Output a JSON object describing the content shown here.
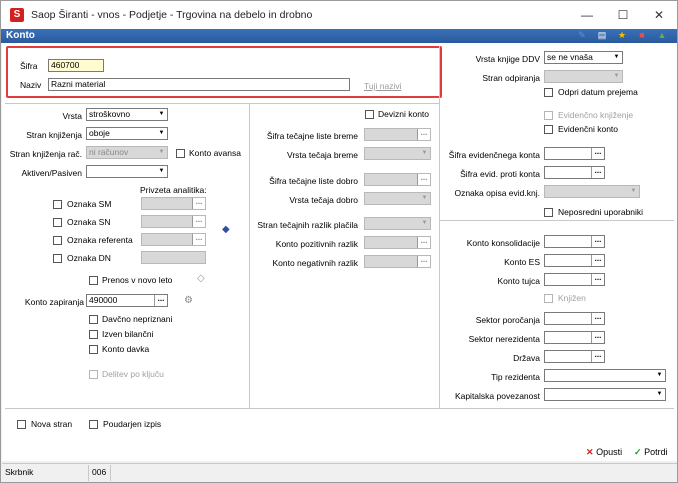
{
  "titlebar": {
    "title": "Saop Širanti - vnos - Podjetje - Trgovina na debelo in drobno",
    "minimize": "—",
    "maximize": "☐",
    "close": "✕"
  },
  "header": {
    "title": "Konto"
  },
  "form": {
    "sifra_label": "Šifra",
    "sifra_value": "460700",
    "naziv_label": "Naziv",
    "naziv_value": "Razni material",
    "tuji_nazivi": "Tuji nazivi",
    "vrsta_label": "Vrsta",
    "vrsta_value": "stroškovno",
    "stran_knjizenja_label": "Stran knjiženja",
    "stran_knjizenja_value": "oboje",
    "stran_knjizenja_rac_label": "Stran knjiženja rač.",
    "stran_knjizenja_rac_value": "ni računov",
    "konto_avansa": "Konto avansa",
    "aktiven_label": "Aktiven/Pasiven",
    "aktiven_value": "",
    "privzeta_analitika": "Privzeta analitika:",
    "oznaka_sm": "Oznaka SM",
    "oznaka_sn": "Oznaka SN",
    "oznaka_referenta": "Oznaka referenta",
    "oznaka_dn": "Oznaka DN",
    "prenos": "Prenos v novo leto",
    "konto_zapiranja_label": "Konto zapiranja",
    "konto_zapiranja_value": "490000",
    "davcno": "Davčno nepriznani",
    "izven": "Izven bilančni",
    "konto_davka": "Konto davka",
    "delitev": "Delitev po ključu",
    "devizni": "Devizni konto",
    "sifra_tecajne_breme": "Šifra tečajne liste breme",
    "vrsta_tecaja_breme": "Vrsta tečaja breme",
    "sifra_tecajne_dobro": "Šifra tečajne liste dobro",
    "vrsta_tecaja_dobro": "Vrsta tečaja dobro",
    "stran_tecajnih": "Stran tečajnih razlik plačila",
    "konto_poz": "Konto pozitivnih razlik",
    "konto_neg": "Konto negativnih razlik",
    "vrsta_knjige_ddv_label": "Vrsta knjige DDV",
    "vrsta_knjige_ddv_value": "se ne vnaša",
    "stran_odpiranja": "Stran odpiranja",
    "odpri_datum": "Odpri datum prejema",
    "evidencno_knjizenje": "Evidenčno knjiženje",
    "evidencni_konto": "Evidenčni konto",
    "sifra_evid_konta": "Šifra evidenčnega konta",
    "sifra_evid_proti": "Šifra evid. proti konta",
    "oznaka_opisa": "Oznaka opisa evid.knj.",
    "neposredni": "Neposredni uporabniki",
    "konto_konsolidacije": "Konto konsolidacije",
    "konto_es": "Konto ES",
    "konto_tujca": "Konto tujca",
    "knjizen": "Knjižen",
    "sektor_porocanja": "Sektor poročanja",
    "sektor_nerezidenta": "Sektor nerezidenta",
    "drzava": "Država",
    "tip_rezidenta": "Tip rezidenta",
    "kapitalska": "Kapitalska povezanost",
    "nova_stran": "Nova stran",
    "poudarjen": "Poudarjen izpis"
  },
  "buttons": {
    "opusti": "Opusti",
    "potrdi": "Potrdi"
  },
  "status": {
    "user": "Skrbnik",
    "code": "006"
  },
  "colors": {
    "accent": "#2a5a9c",
    "highlight": "#e03c3c",
    "input_yellow": "#fffcd2"
  }
}
